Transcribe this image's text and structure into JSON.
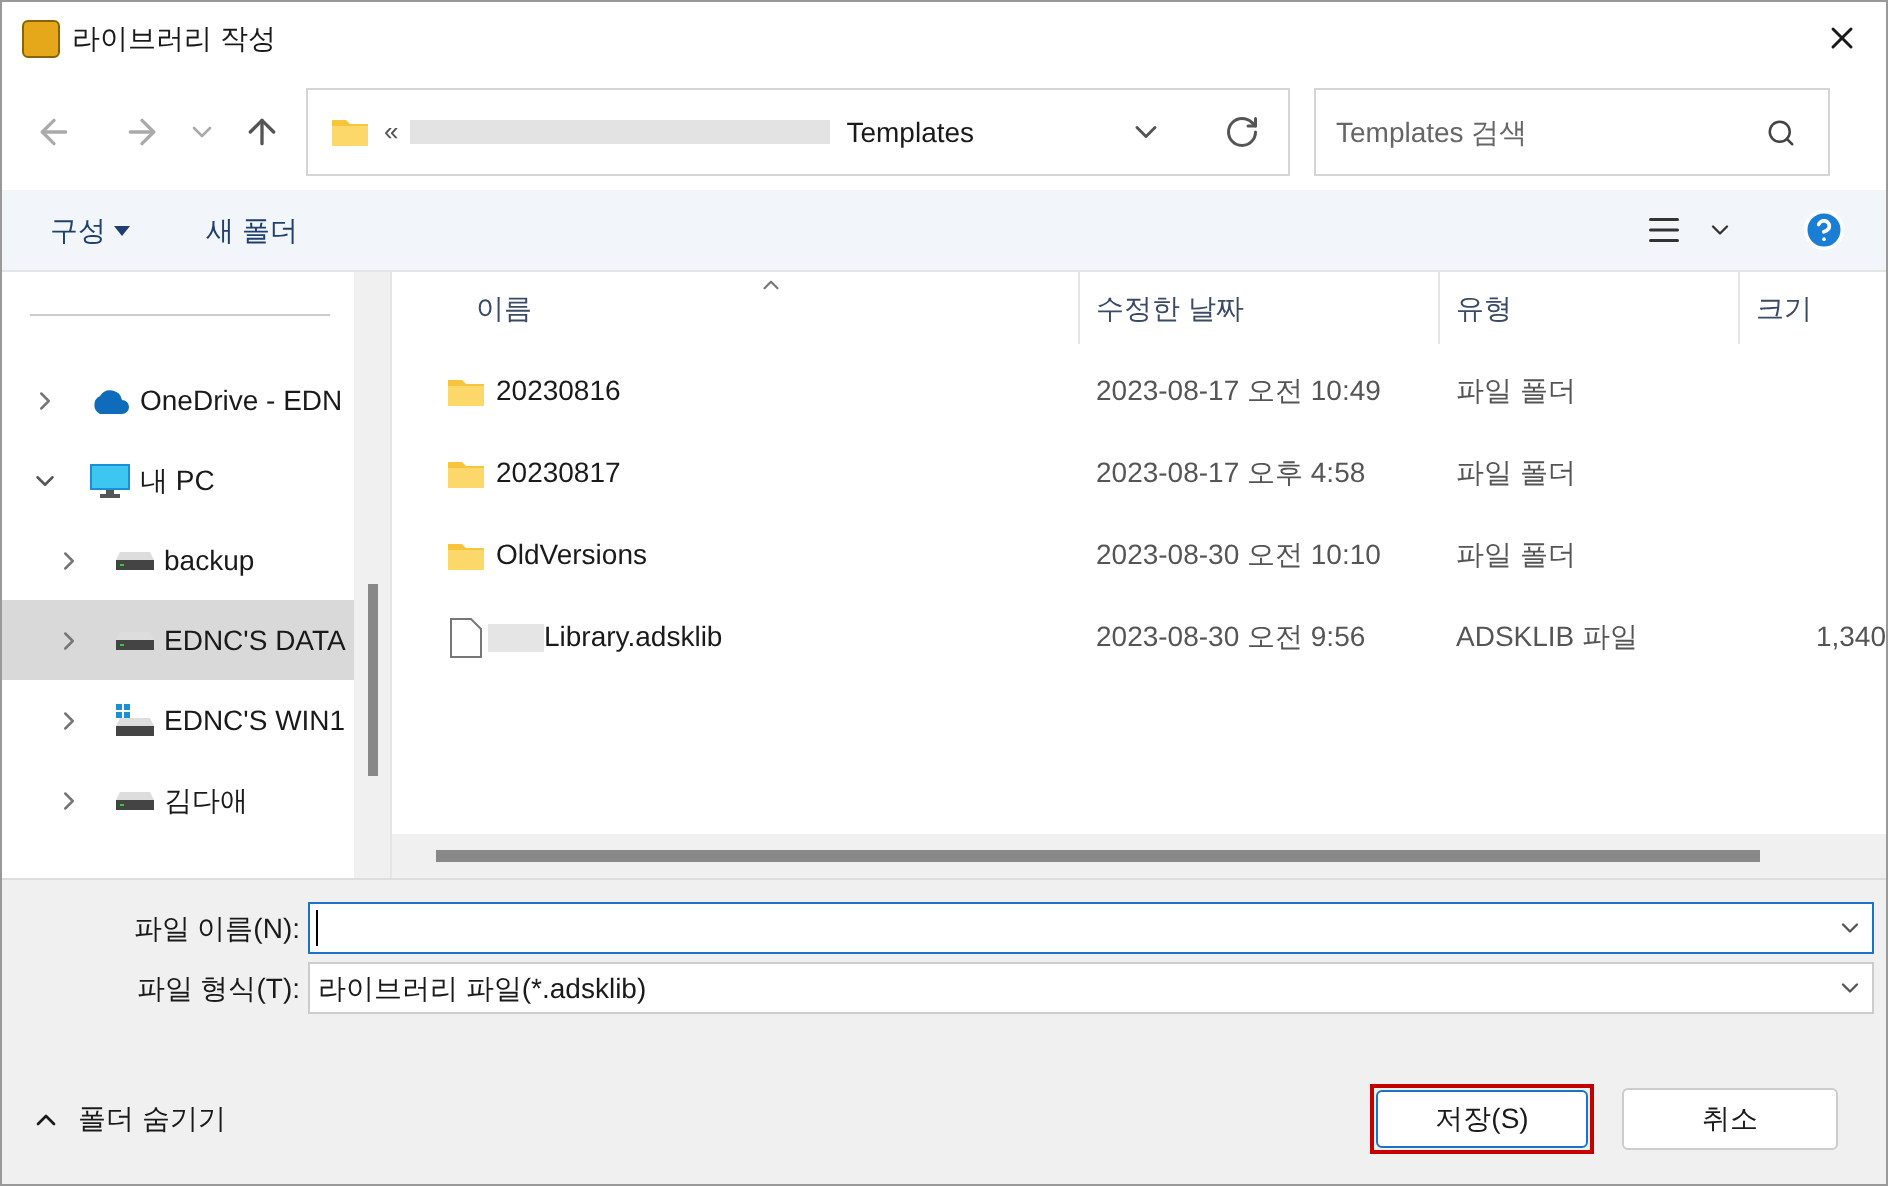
{
  "window": {
    "title": "라이브러리 작성"
  },
  "address": {
    "prefix": "«",
    "path_blurred": true,
    "folder": "Templates"
  },
  "search": {
    "placeholder": "Templates 검색"
  },
  "toolbar": {
    "organize": "구성",
    "new_folder": "새 폴더"
  },
  "sidebar": {
    "items": [
      {
        "label": "OneDrive - EDN",
        "kind": "cloud",
        "expanded": false,
        "selected": false
      },
      {
        "label": "내 PC",
        "kind": "pc",
        "expanded": true,
        "selected": false,
        "children": [
          {
            "label": "backup",
            "kind": "drive",
            "expanded": false,
            "selected": false
          },
          {
            "label": "EDNC'S DATA",
            "kind": "drive",
            "expanded": false,
            "selected": true
          },
          {
            "label": "EDNC'S WIN1",
            "kind": "system",
            "expanded": false,
            "selected": false
          },
          {
            "label": "김다애",
            "kind": "drive",
            "expanded": false,
            "selected": false
          }
        ]
      }
    ]
  },
  "table": {
    "columns": [
      "이름",
      "수정한 날짜",
      "유형",
      "크기"
    ],
    "rows": [
      {
        "kind": "folder",
        "name_blurred": false,
        "name": "20230816",
        "modified": "2023-08-17 오전 10:49",
        "type": "파일 폴더"
      },
      {
        "kind": "folder",
        "name_blurred": false,
        "name": "20230817",
        "modified": "2023-08-17 오후 4:58",
        "type": "파일 폴더"
      },
      {
        "kind": "folder",
        "name_blurred": false,
        "name": "OldVersions",
        "modified": "2023-08-30 오전 10:10",
        "type": "파일 폴더"
      },
      {
        "kind": "file",
        "name_blurred": true,
        "name": "Library.adsklib",
        "modified": "2023-08-30 오전 9:56",
        "type": "ADSKLIB 파일",
        "size": "1,340"
      }
    ]
  },
  "form": {
    "filename_label": "파일 이름(N):",
    "filetype_label": "파일 형식(T):",
    "filetype_value": "라이브러리 파일(*.adsklib)"
  },
  "footer": {
    "hide_folders": "폴더 숨기기",
    "save": "저장(S)",
    "cancel": "취소"
  }
}
